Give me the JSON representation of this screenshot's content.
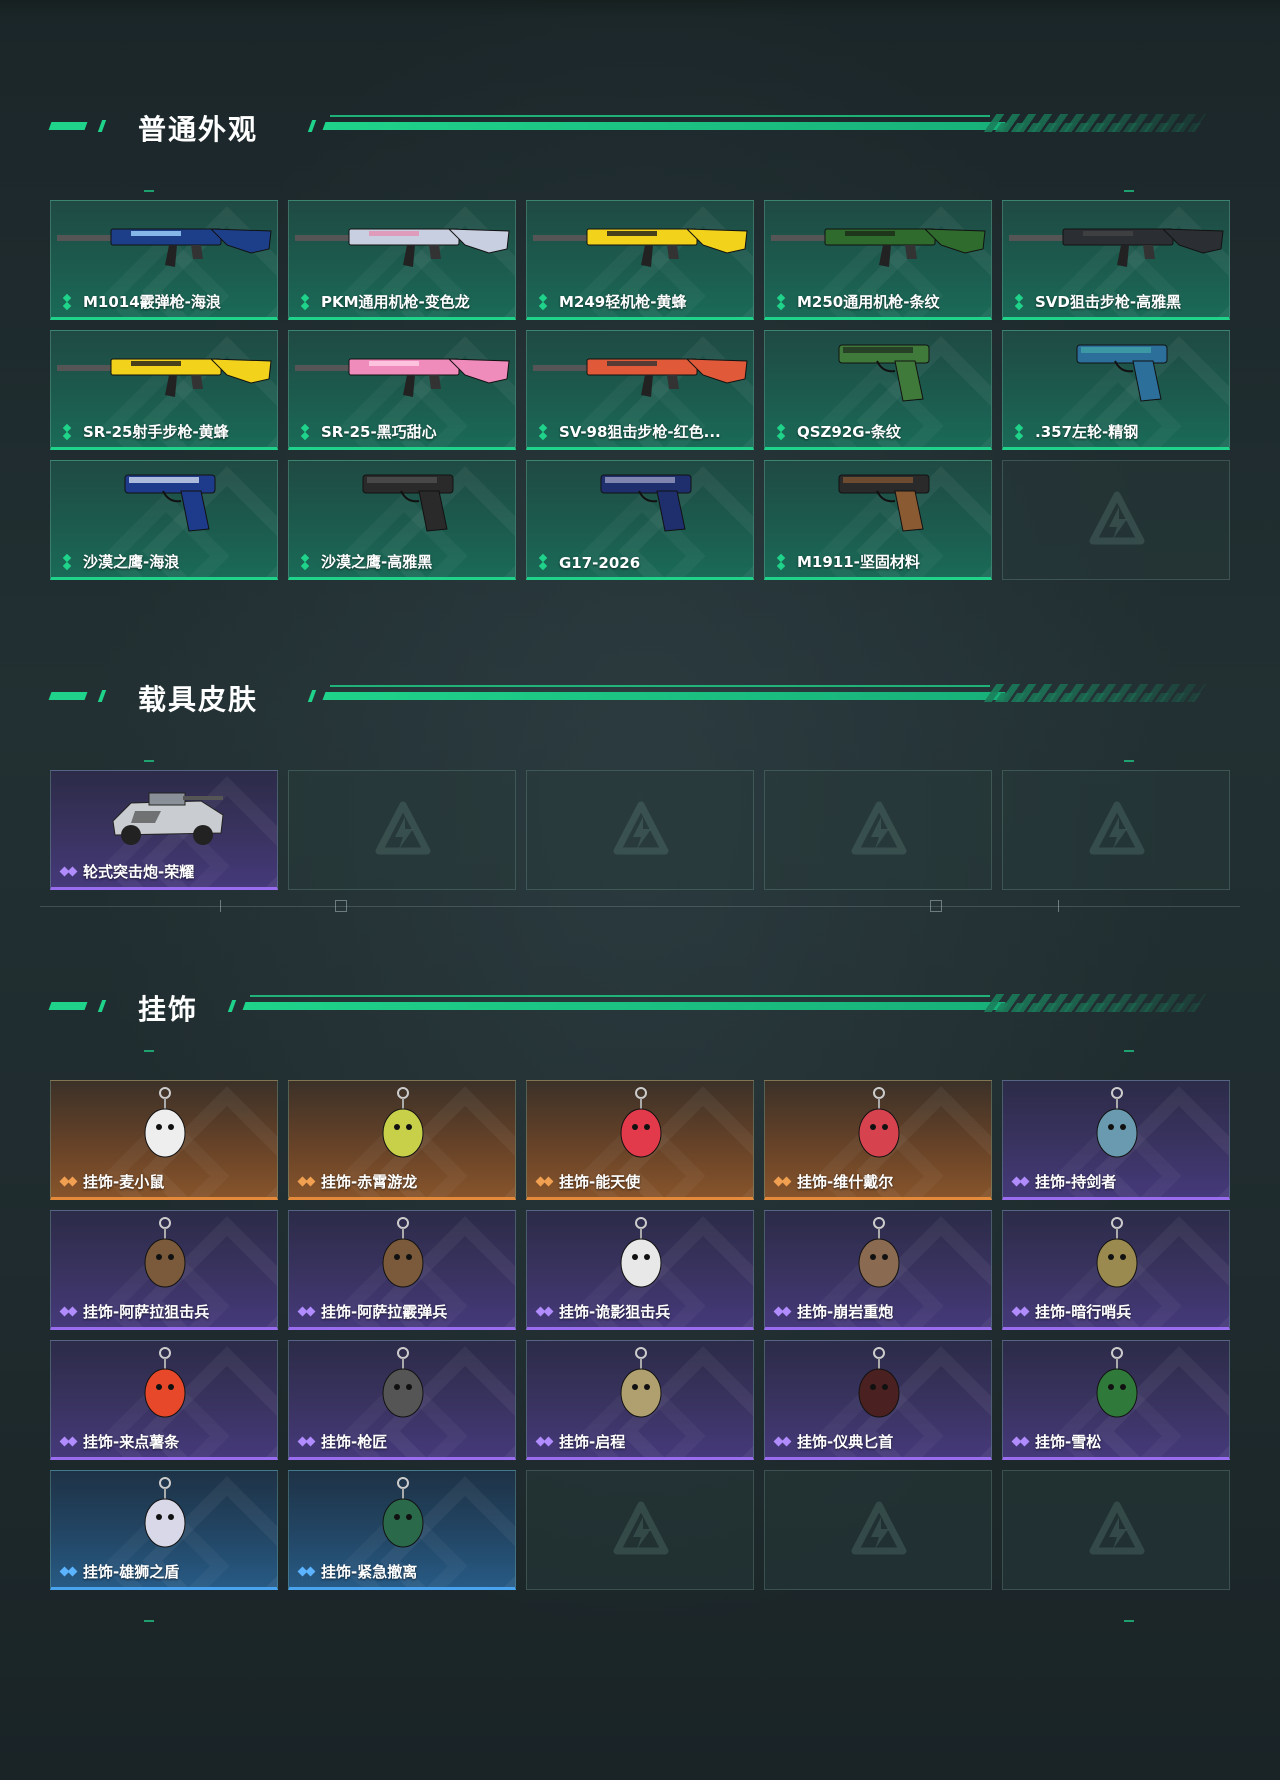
{
  "sections": {
    "normal": {
      "title": "普通外观"
    },
    "vehicle": {
      "title": "载具皮肤"
    },
    "charm": {
      "title": "挂饰"
    }
  },
  "normal_items": [
    {
      "label": "M1014霰弹枪-海浪",
      "rarity": "green"
    },
    {
      "label": "PKM通用机枪-变色龙",
      "rarity": "green"
    },
    {
      "label": "M249轻机枪-黄蜂",
      "rarity": "green"
    },
    {
      "label": "M250通用机枪-条纹",
      "rarity": "green"
    },
    {
      "label": "SVD狙击步枪-高雅黑",
      "rarity": "green"
    },
    {
      "label": "SR-25射手步枪-黄蜂",
      "rarity": "green"
    },
    {
      "label": "SR-25-黑巧甜心",
      "rarity": "green"
    },
    {
      "label": "SV-98狙击步枪-红色...",
      "rarity": "green"
    },
    {
      "label": "QSZ92G-条纹",
      "rarity": "green"
    },
    {
      "label": ".357左轮-精钢",
      "rarity": "green"
    },
    {
      "label": "沙漠之鹰-海浪",
      "rarity": "green"
    },
    {
      "label": "沙漠之鹰-高雅黑",
      "rarity": "green"
    },
    {
      "label": "G17-2026",
      "rarity": "green"
    },
    {
      "label": "M1911-坚固材料",
      "rarity": "green"
    }
  ],
  "vehicle_items": [
    {
      "label": "轮式突击炮-荣耀",
      "rarity": "purple"
    }
  ],
  "charm_items": [
    {
      "label": "挂饰-麦小鼠",
      "rarity": "orange"
    },
    {
      "label": "挂饰-赤霄游龙",
      "rarity": "orange"
    },
    {
      "label": "挂饰-能天使",
      "rarity": "orange"
    },
    {
      "label": "挂饰-维什戴尔",
      "rarity": "orange"
    },
    {
      "label": "挂饰-持剑者",
      "rarity": "purple"
    },
    {
      "label": "挂饰-阿萨拉狙击兵",
      "rarity": "purple"
    },
    {
      "label": "挂饰-阿萨拉霰弹兵",
      "rarity": "purple"
    },
    {
      "label": "挂饰-诡影狙击兵",
      "rarity": "purple"
    },
    {
      "label": "挂饰-崩岩重炮",
      "rarity": "purple"
    },
    {
      "label": "挂饰-暗行哨兵",
      "rarity": "purple"
    },
    {
      "label": "挂饰-来点薯条",
      "rarity": "purple"
    },
    {
      "label": "挂饰-枪匠",
      "rarity": "purple"
    },
    {
      "label": "挂饰-启程",
      "rarity": "purple"
    },
    {
      "label": "挂饰-仪典匕首",
      "rarity": "purple"
    },
    {
      "label": "挂饰-雪松",
      "rarity": "purple"
    },
    {
      "label": "挂饰-雄狮之盾",
      "rarity": "blue"
    },
    {
      "label": "挂饰-紧急撤离",
      "rarity": "blue"
    }
  ],
  "colors": {
    "accent": "#1fd38a",
    "green_rarity": "#1fd38a",
    "purple_rarity": "#9a6cf0",
    "orange_rarity": "#e48a3a",
    "blue_rarity": "#4aa3ee"
  }
}
